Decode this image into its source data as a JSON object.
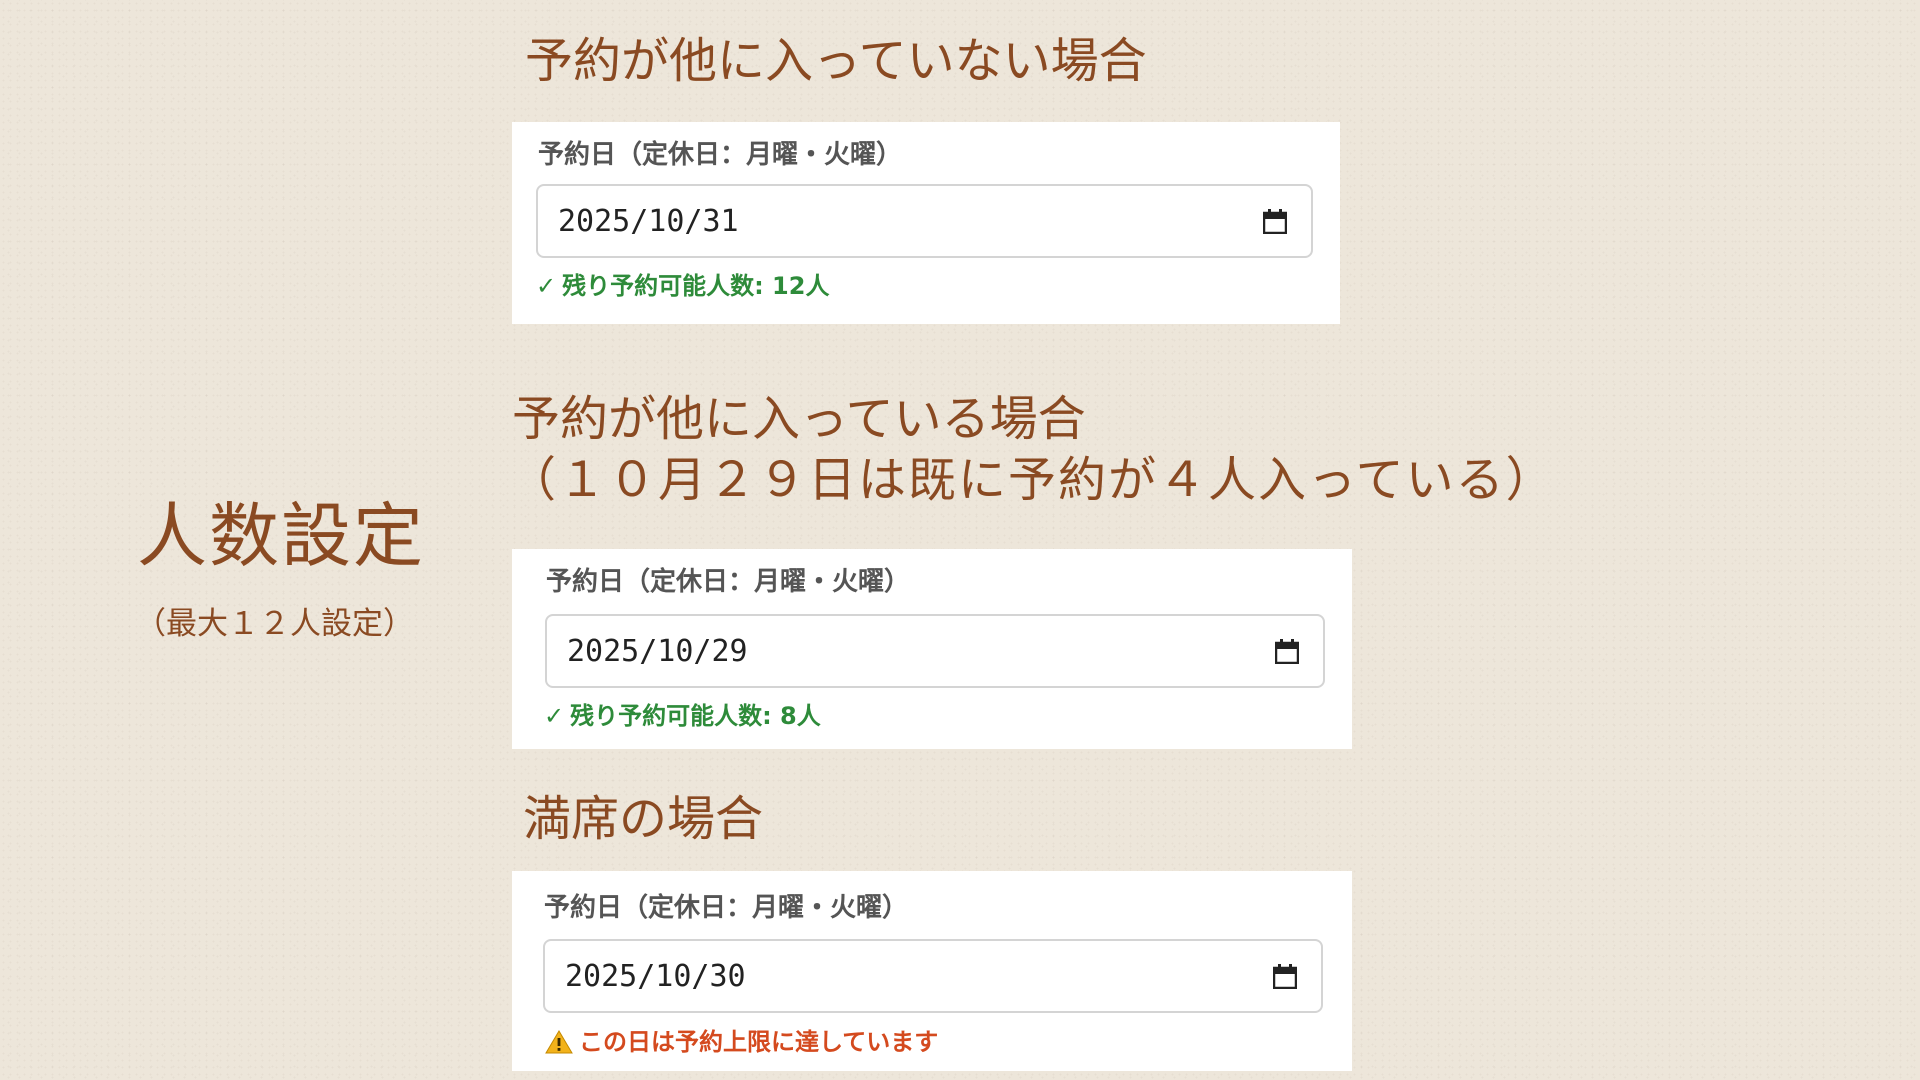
{
  "left": {
    "title": "人数設定",
    "subtitle": "（最大１２人設定）"
  },
  "sections": [
    {
      "heading": "予約が他に入っていない場合",
      "label": "予約日（定休日：月曜・火曜）",
      "date": "2025/10/31",
      "status": "残り予約可能人数: 12人",
      "status_icon": "✓"
    },
    {
      "heading_line1": "予約が他に入っている場合",
      "heading_line2": "（１０月２９日は既に予約が４人入っている）",
      "label": "予約日（定休日：月曜・火曜）",
      "date": "2025/10/29",
      "status": "残り予約可能人数: 8人",
      "status_icon": "✓"
    },
    {
      "heading": "満席の場合",
      "label": "予約日（定休日：月曜・火曜）",
      "date": "2025/10/30",
      "status": "この日は予約上限に達しています",
      "status_icon": "warning-icon"
    }
  ],
  "colors": {
    "heading": "#8a4a22",
    "success": "#2e8b3a",
    "error": "#d44a1e"
  }
}
